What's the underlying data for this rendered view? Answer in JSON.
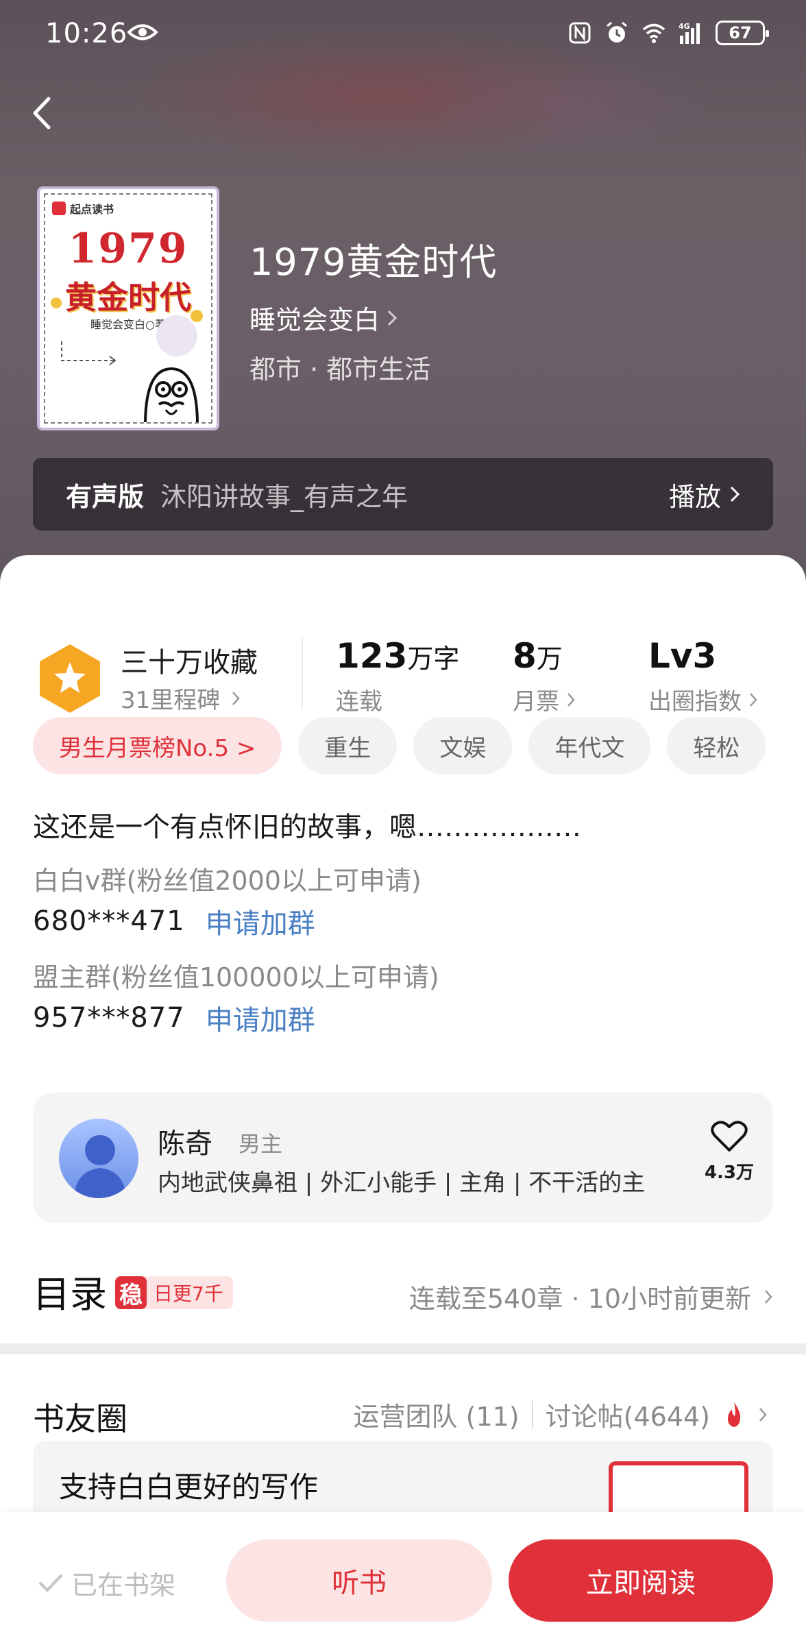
{
  "status_bar": {
    "time": "10:26",
    "battery": "67",
    "network": "4G"
  },
  "book": {
    "title": "1979黄金时代",
    "author": "睡觉会变白",
    "genre": "都市 · 都市生活",
    "cover": {
      "brand": "起点读书",
      "year": "1979",
      "title": "黄金时代",
      "author": "睡觉会变白○著"
    }
  },
  "audio": {
    "label": "有声版",
    "narrator": "沐阳讲故事_有声之年",
    "play_label": "播放"
  },
  "stats": {
    "favorites": {
      "title": "三十万收藏",
      "subtitle": "31里程碑"
    },
    "words": {
      "value": "123",
      "unit": "万字",
      "label": "连载"
    },
    "monthly": {
      "value": "8",
      "unit": "万",
      "label": "月票"
    },
    "level": {
      "value": "Lv3",
      "label": "出圈指数"
    }
  },
  "tags": [
    "男生月票榜No.5 >",
    "重生",
    "文娱",
    "年代文",
    "轻松"
  ],
  "description": {
    "intro": "这还是一个有点怀旧的故事，嗯………………",
    "groups": [
      {
        "title": "白白v群(粉丝值2000以上可申请)",
        "number": "680***471",
        "action": "申请加群"
      },
      {
        "title": "盟主群(粉丝值100000以上可申请)",
        "number": "957***877",
        "action": "申请加群"
      }
    ]
  },
  "character": {
    "name": "陈奇",
    "role": "男主",
    "description": "内地武侠鼻祖 | 外汇小能手 | 主角 | 不干活的主",
    "likes": "4.3万"
  },
  "toc": {
    "title": "目录",
    "badge_icon": "稳",
    "badge_text": "日更7千",
    "update": "连载至540章 · 10小时前更新"
  },
  "friends": {
    "title": "书友圈",
    "team": "运营团队 (11)",
    "posts": "讨论帖(4644)",
    "post_title": "支持白白更好的写作"
  },
  "bottom": {
    "shelf_label": "已在书架",
    "listen_label": "听书",
    "read_label": "立即阅读"
  },
  "colors": {
    "accent": "#e0313a",
    "link": "#4a7fc4",
    "badge_gold": "#f6a623"
  }
}
